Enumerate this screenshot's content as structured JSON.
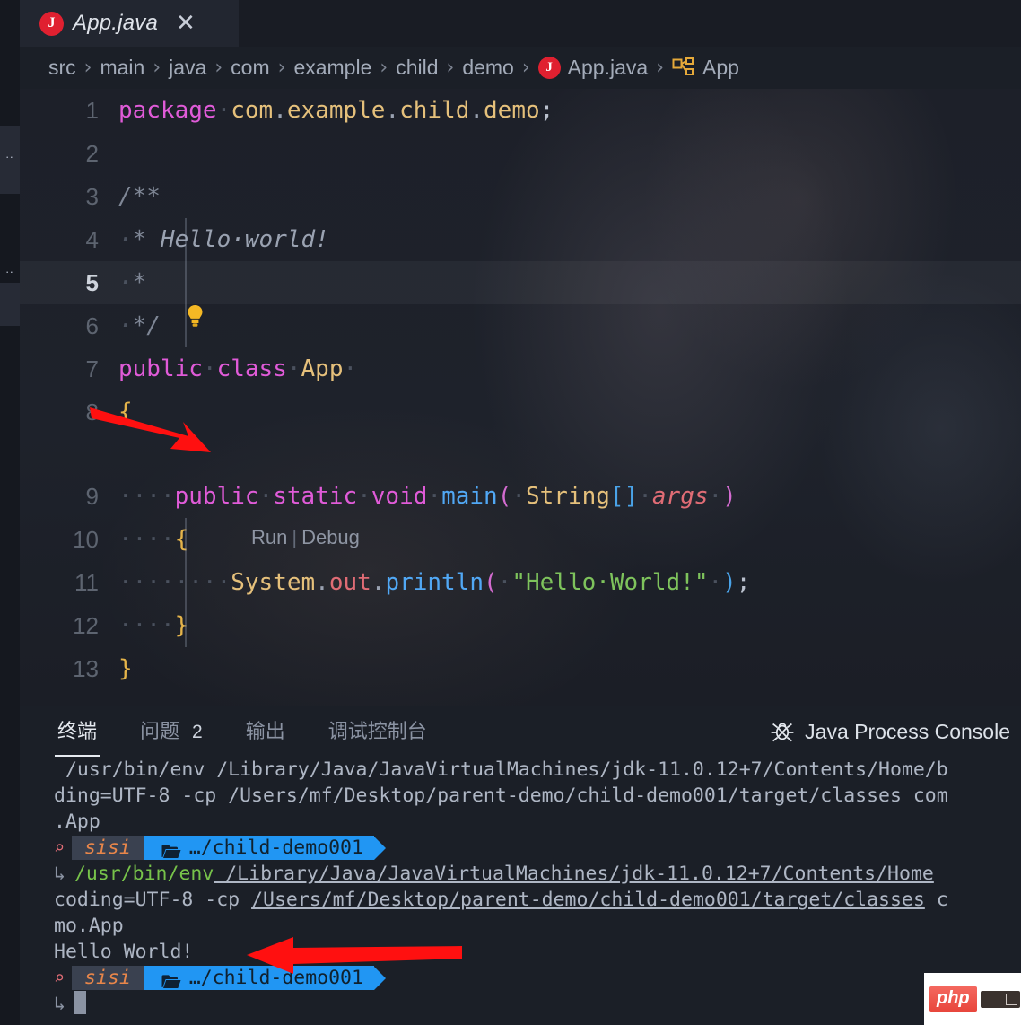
{
  "window": {
    "tab": {
      "label": "App.java",
      "icon": "java-class-icon",
      "close_icon": "✕"
    }
  },
  "breadcrumb": {
    "separator": "›",
    "items": [
      {
        "label": "src",
        "icon": null
      },
      {
        "label": "main",
        "icon": null
      },
      {
        "label": "java",
        "icon": null
      },
      {
        "label": "com",
        "icon": null
      },
      {
        "label": "example",
        "icon": null
      },
      {
        "label": "child",
        "icon": null
      },
      {
        "label": "demo",
        "icon": null
      },
      {
        "label": "App.java",
        "icon": "java-file-icon"
      },
      {
        "label": "App",
        "icon": "class-symbol-icon"
      }
    ]
  },
  "editor": {
    "language": "java",
    "current_line": 5,
    "codelens": {
      "run": "Run",
      "separator": "|",
      "debug": "Debug"
    },
    "lightbulb_icon": "lightbulb-icon",
    "lines": [
      {
        "no": "1",
        "text": "package com.example.child.demo;"
      },
      {
        "no": "2",
        "text": ""
      },
      {
        "no": "3",
        "text": "/**"
      },
      {
        "no": "4",
        "text": " * Hello world!"
      },
      {
        "no": "5",
        "text": " *"
      },
      {
        "no": "6",
        "text": " */"
      },
      {
        "no": "7",
        "text": "public class App"
      },
      {
        "no": "8",
        "text": "{"
      },
      {
        "no": "9",
        "text": "    public static void main( String[] args )"
      },
      {
        "no": "10",
        "text": "    {"
      },
      {
        "no": "11",
        "text": "        System.out.println( \"Hello World!\" );"
      },
      {
        "no": "12",
        "text": "    }"
      },
      {
        "no": "13",
        "text": "}"
      }
    ]
  },
  "panel": {
    "tabs": [
      {
        "label": "终端",
        "badge": null,
        "active": true
      },
      {
        "label": "问题",
        "badge": "2",
        "active": false
      },
      {
        "label": "输出",
        "badge": null,
        "active": false
      },
      {
        "label": "调试控制台",
        "badge": null,
        "active": false
      }
    ],
    "right": {
      "label": "Java Process Console",
      "icon": "bug-icon"
    }
  },
  "terminal": {
    "prompt": {
      "user": "sisi",
      "dir": "…/child-demo001",
      "bolt": "┌",
      "cont": "└",
      "folder_icon": "folder-icon"
    },
    "rows": [
      {
        "type": "out",
        "text": " /usr/bin/env /Library/Java/JavaVirtualMachines/jdk-11.0.12+7/Contents/Home/b"
      },
      {
        "type": "out",
        "text": "ding=UTF-8 -cp /Users/mf/Desktop/parent-demo/child-demo001/target/classes com"
      },
      {
        "type": "out",
        "text": ".App"
      },
      {
        "type": "prompt"
      },
      {
        "type": "cmd",
        "cont": "↳",
        "cmd": "/usr/bin/env",
        "rest": " /Library/Java/JavaVirtualMachines/jdk-11.0.12+7/Contents/Home"
      },
      {
        "type": "cmd2",
        "pre": "coding=UTF-8 -cp ",
        "path": "/Users/mf/Desktop/parent-demo/child-demo001/target/classes",
        "tail": " c"
      },
      {
        "type": "out",
        "text": "mo.App"
      },
      {
        "type": "out",
        "text": "Hello World!"
      },
      {
        "type": "prompt"
      },
      {
        "type": "cursor",
        "cont": "↳"
      }
    ]
  },
  "watermark": {
    "label": "php"
  },
  "colors": {
    "accent_red": "#e02030",
    "prompt_blue": "#2196f3",
    "prompt_orange": "#e8864a",
    "string_green": "#7ec35c",
    "keyword_pink": "#e05bd8",
    "type_gold": "#e5c07b",
    "method_blue": "#51a8f5",
    "arrow_red": "#ff1010"
  }
}
